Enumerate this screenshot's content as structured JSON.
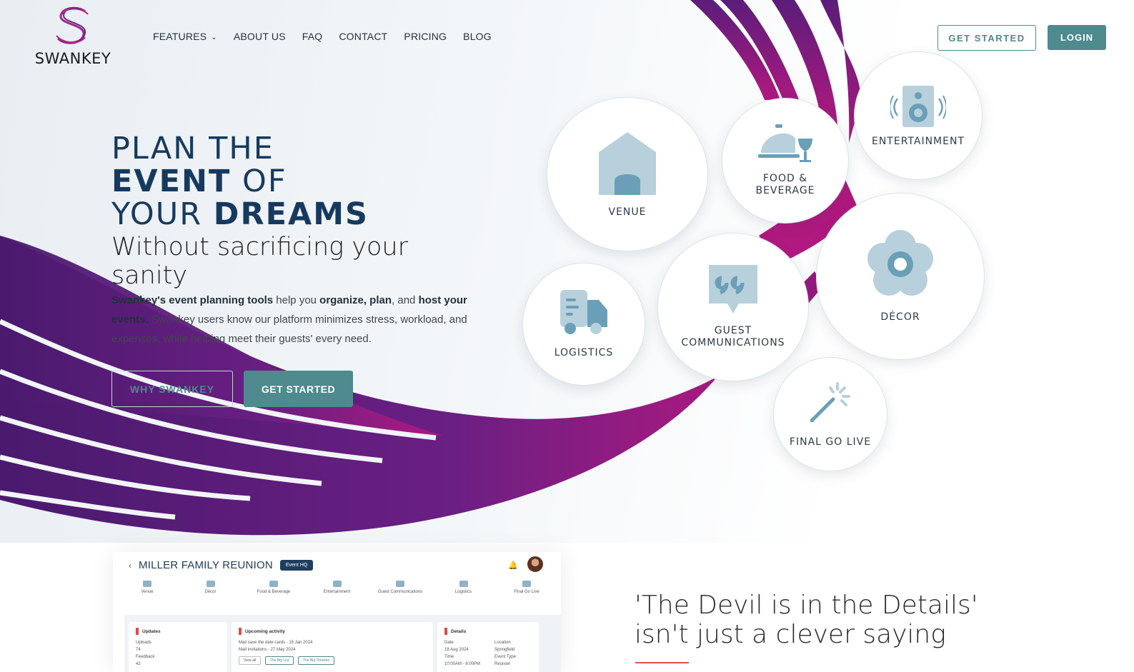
{
  "brand": {
    "name": "SWANKEY"
  },
  "nav": {
    "items": [
      {
        "label": "FEATURES",
        "has_dropdown": true
      },
      {
        "label": "ABOUT US"
      },
      {
        "label": "FAQ"
      },
      {
        "label": "CONTACT"
      },
      {
        "label": "PRICING"
      },
      {
        "label": "BLOG"
      }
    ],
    "get_started": "GET STARTED",
    "login": "LOGIN"
  },
  "hero": {
    "title_line1": "PLAN THE",
    "title_line2_bold": "EVENT",
    "title_line2_rest": " OF",
    "title_line3_regular": "YOUR ",
    "title_line3_bold": "DREAMS",
    "subtitle": "Without sacrificing your sanity",
    "body_b1": "Swankey's event planning tools",
    "body_t1": " help you ",
    "body_b2": "organize, plan",
    "body_t2": ", and ",
    "body_b3": "host your events.",
    "body_t3": " Swankey users know our platform minimizes stress, workload, and expenses, while helping  meet their guests' every need.",
    "why_button": "WHY SWANKEY",
    "cta_button": "GET STARTED"
  },
  "features": [
    {
      "key": "venue",
      "label": "VENUE",
      "icon": "house-icon"
    },
    {
      "key": "food",
      "label": "FOOD & BEVERAGE",
      "icon": "cloche-icon"
    },
    {
      "key": "entertainment",
      "label": "ENTERTAINMENT",
      "icon": "speaker-icon"
    },
    {
      "key": "decor",
      "label": "DÉCOR",
      "icon": "flower-icon"
    },
    {
      "key": "guest",
      "label": "GUEST COMMUNICATIONS",
      "icon": "quote-bubble-icon"
    },
    {
      "key": "logistics",
      "label": "LOGISTICS",
      "icon": "truck-icon"
    },
    {
      "key": "golive",
      "label": "FINAL GO LIVE",
      "icon": "magic-wand-icon"
    }
  ],
  "dashboard": {
    "title": "MILLER FAMILY REUNION",
    "badge": "Event HQ",
    "tabs": [
      "Venue",
      "Décor",
      "Food & Beverage",
      "Entertainment",
      "Guest Communications",
      "Logistics",
      "Final Go Live"
    ],
    "updates": {
      "title": "Updates",
      "uploads_label": "Uploads",
      "uploads_value": "74",
      "feedback_label": "Feedback",
      "feedback_value": "42"
    },
    "activity": {
      "title": "Upcoming activity",
      "line1": "Mail save the date cards - 15 Jan 2024",
      "line2": "Mail invitations - 27 May 2024",
      "btn_view": "View all",
      "btn_list": "The Big List",
      "btn_timeline": "The Big Timeline"
    },
    "details": {
      "title": "Details",
      "date_label": "Date",
      "date_value": "18 Aug 2024",
      "location_label": "Location",
      "location_value": "Springfield",
      "time_label": "Time",
      "time_value": "10:00AM - 6:00PM",
      "type_label": "Event Type",
      "type_value": "Reunion"
    }
  },
  "quote": {
    "line1": "'The Devil is in the Details'",
    "line2": "isn't just a clever saying"
  },
  "colors": {
    "teal": "#4e8a8e",
    "navy": "#163a5f",
    "purple": "#5b1d7a",
    "magenta": "#b0197f",
    "icon_light": "#b7d0dc",
    "icon_dark": "#6b9fb8",
    "accent_red": "#e05058"
  }
}
